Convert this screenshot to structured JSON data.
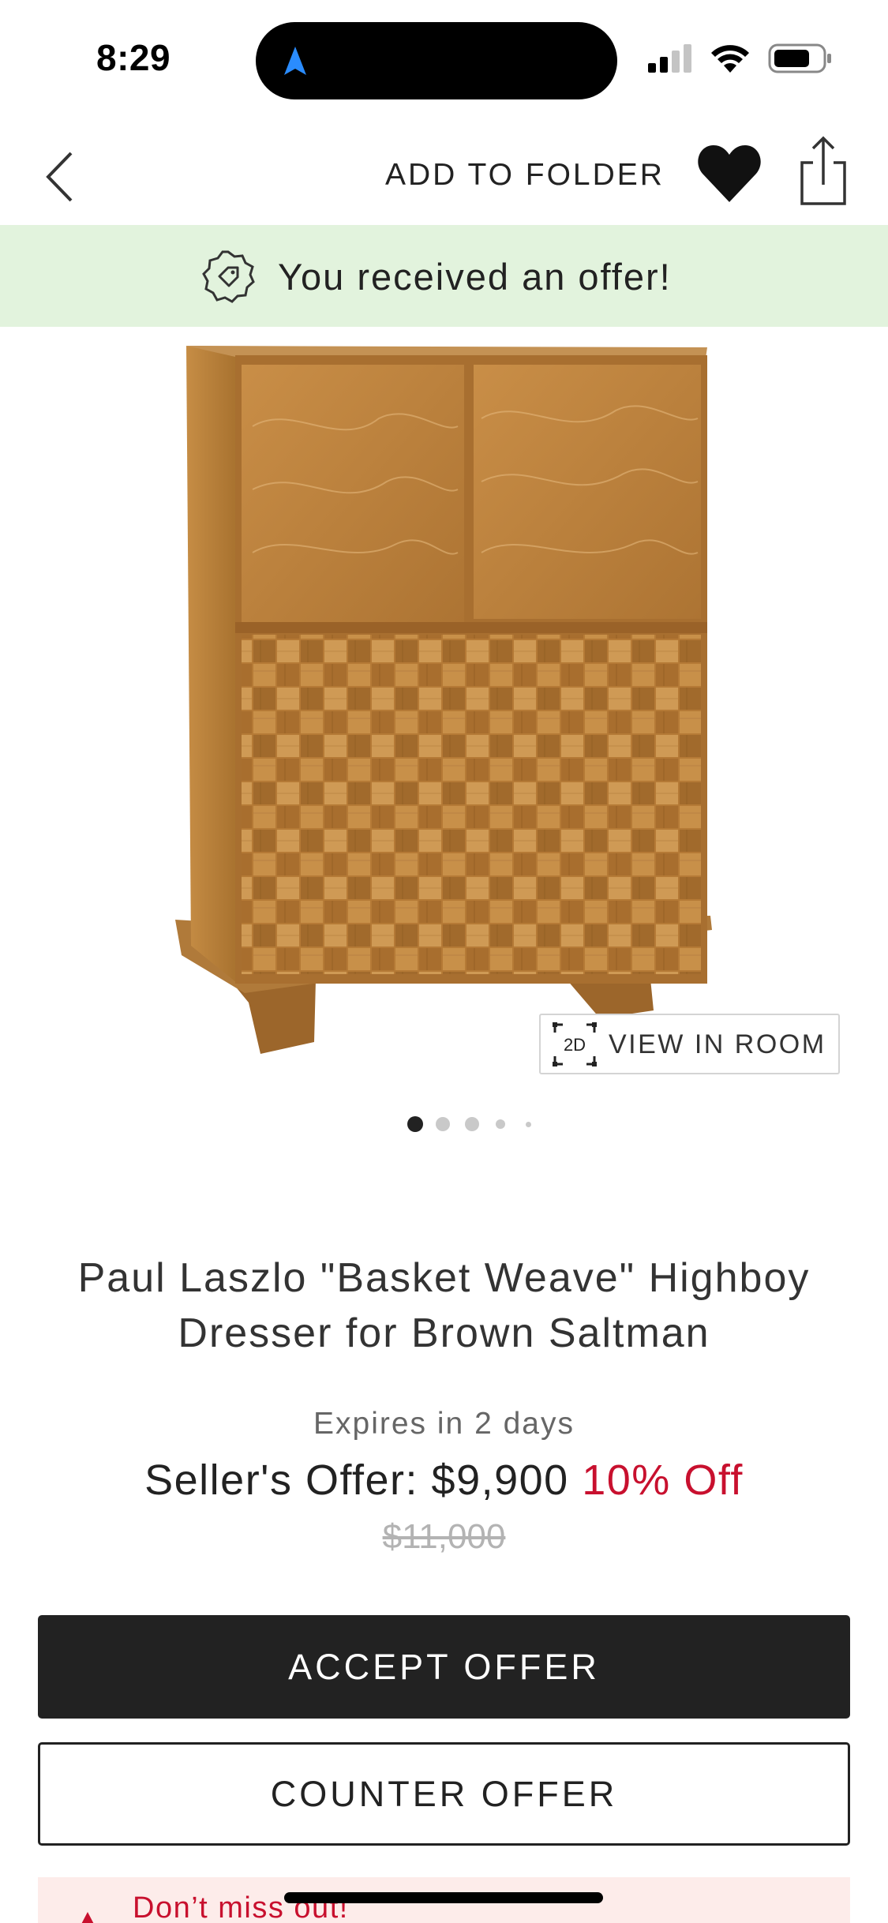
{
  "status_bar": {
    "time": "8:29"
  },
  "nav": {
    "add_to_folder_label": "ADD TO FOLDER",
    "back_icon": "chevron-left-icon",
    "favorite_icon": "heart-icon",
    "share_icon": "share-icon"
  },
  "offer_banner": {
    "text": "You received an offer!",
    "icon": "tag-icon",
    "background": "#e2f3dd"
  },
  "product_image": {
    "view_in_room_label": "VIEW IN ROOM",
    "view_in_room_icon_text": "2D",
    "image_count": 5,
    "current_image_index": 0
  },
  "product": {
    "title_line_1": "Paul Laszlo \"Basket Weave\" Highboy",
    "title_line_2": "Dresser for Brown Saltman",
    "expires_text": "Expires in 2 days",
    "offer_label": "Seller's Offer: $9,900",
    "discount_label": "10% Off",
    "original_price": "$11,000"
  },
  "actions": {
    "accept_label": "ACCEPT OFFER",
    "counter_label": "COUNTER OFFER"
  },
  "alert": {
    "text": "Don’t miss out!"
  },
  "colors": {
    "accent_red": "#c8102e",
    "primary_button": "#222222",
    "banner_green": "#e2f3dd",
    "alert_bg": "#fdecea"
  }
}
